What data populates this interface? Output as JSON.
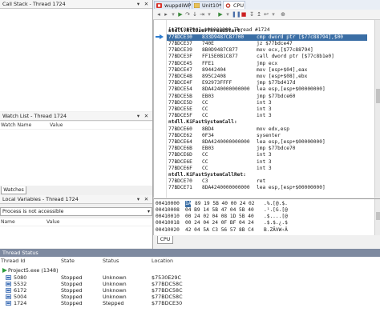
{
  "call_stack": {
    "title": "Call Stack - Thread 1724"
  },
  "watch_list": {
    "title": "Watch List - Thread 1724",
    "columns": [
      "Watch Name",
      "Value"
    ],
    "tab": "Watches"
  },
  "local_variables": {
    "title": "Local Variables - Thread 1724",
    "dropdown_value": "Process is not accessible",
    "columns": [
      "Name",
      "Value"
    ]
  },
  "panel_buttons": {
    "pin": "▾",
    "close": "✕"
  },
  "tabs": [
    {
      "label": "wuppdiWP",
      "icon": "delphi-icon",
      "color": "#d9342b"
    },
    {
      "label": "Unit10*",
      "icon": "unit-icon",
      "color": "#c28a1e"
    },
    {
      "label": "CPU",
      "icon": "cpu-icon",
      "color": "#c0392b",
      "active": true
    }
  ],
  "disassembly": {
    "header": "[$77C88794]=$00000000 Thread #1724",
    "lines": [
      {
        "kind": "label",
        "text": "ntdll.RtlUserThreadStart:"
      },
      {
        "addr": "77BDCE30",
        "bytes": "833D9487C87700",
        "instr": "cmp dword ptr [$77c88794],$00",
        "selected": true
      },
      {
        "addr": "77BDCE37",
        "bytes": "740E",
        "instr": "jz $77bdce47"
      },
      {
        "addr": "77BDCE39",
        "bytes": "8B0D9487C877",
        "instr": "mov ecx,[$77c88794]"
      },
      {
        "addr": "77BDCE3F",
        "bytes": "FF15E0B1C877",
        "instr": "call dword ptr [$77c8b1e0]"
      },
      {
        "addr": "77BDCE45",
        "bytes": "FFE1",
        "instr": "jmp ecx"
      },
      {
        "addr": "77BDCE47",
        "bytes": "89442404",
        "instr": "mov [esp+$04],eax"
      },
      {
        "addr": "77BDCE4B",
        "bytes": "895C2408",
        "instr": "mov [esp+$08],ebx"
      },
      {
        "addr": "77BDCE4F",
        "bytes": "E92973FFFF",
        "instr": "jmp $77bd417d"
      },
      {
        "addr": "77BDCE54",
        "bytes": "8DA4240000000000",
        "instr": "lea esp,[esp+$00000000]"
      },
      {
        "addr": "77BDCE5B",
        "bytes": "EB03",
        "instr": "jmp $77bdce60"
      },
      {
        "addr": "77BDCE5D",
        "bytes": "CC",
        "instr": "int 3"
      },
      {
        "addr": "77BDCE5E",
        "bytes": "CC",
        "instr": "int 3"
      },
      {
        "addr": "77BDCE5F",
        "bytes": "CC",
        "instr": "int 3"
      },
      {
        "kind": "label",
        "text": "ntdll.KiFastSystemCall:"
      },
      {
        "addr": "77BDCE60",
        "bytes": "8BD4",
        "instr": "mov edx,esp"
      },
      {
        "addr": "77BDCE62",
        "bytes": "0F34",
        "instr": "sysenter"
      },
      {
        "addr": "77BDCE64",
        "bytes": "8DA4240000000000",
        "instr": "lea esp,[esp+$00000000]"
      },
      {
        "addr": "77BDCE6B",
        "bytes": "EB03",
        "instr": "jmp $77bdce70"
      },
      {
        "addr": "77BDCE6D",
        "bytes": "CC",
        "instr": "int 3"
      },
      {
        "addr": "77BDCE6E",
        "bytes": "CC",
        "instr": "int 3"
      },
      {
        "addr": "77BDCE6F",
        "bytes": "CC",
        "instr": "int 3"
      },
      {
        "kind": "label",
        "text": "ntdll.KiFastSystemCallRet:"
      },
      {
        "addr": "77BDCE70",
        "bytes": "C3",
        "instr": "ret"
      },
      {
        "addr": "77BDCE71",
        "bytes": "8DA4240000000000",
        "instr": "lea esp,[esp+$00000000]"
      }
    ]
  },
  "memory_dump": {
    "lines": [
      {
        "addr": "00410000",
        "first": "1A",
        "hex": "89 19 5B 40 00 24 02",
        "ascii": ".%.[@.$."
      },
      {
        "addr": "00410008",
        "hex": "04 B9 14 5B 47 04 5B 40",
        "ascii": ".¹.[G.[@"
      },
      {
        "addr": "00410010",
        "hex": "00 24 02 04 08 1D 5B 40",
        "ascii": ".$....[@"
      },
      {
        "addr": "00410018",
        "hex": "00 24 04 24 0F BF 04 24",
        "ascii": ".$.$.¿.$"
      },
      {
        "addr": "00410020",
        "hex": "42 04 5A C3 56 57 8B C4",
        "ascii": "B.ZÃVW‹Ä"
      }
    ]
  },
  "bottom_tab": "CPU",
  "thread_status": {
    "title": "Thread Status",
    "columns": [
      "Thread Id",
      "State",
      "Status",
      "Location"
    ],
    "process": "Project5.exe (1348)",
    "threads": [
      {
        "id": "5080",
        "state": "Stopped",
        "status": "Unknown",
        "location": "$7530E29C"
      },
      {
        "id": "5532",
        "state": "Stopped",
        "status": "Unknown",
        "location": "$77BDC58C"
      },
      {
        "id": "6172",
        "state": "Stopped",
        "status": "Unknown",
        "location": "$77BDC58C"
      },
      {
        "id": "5004",
        "state": "Stopped",
        "status": "Unknown",
        "location": "$77BDC58C"
      },
      {
        "id": "1724",
        "state": "Stopped",
        "status": "Stepped",
        "location": "$77BDCE30"
      }
    ]
  }
}
